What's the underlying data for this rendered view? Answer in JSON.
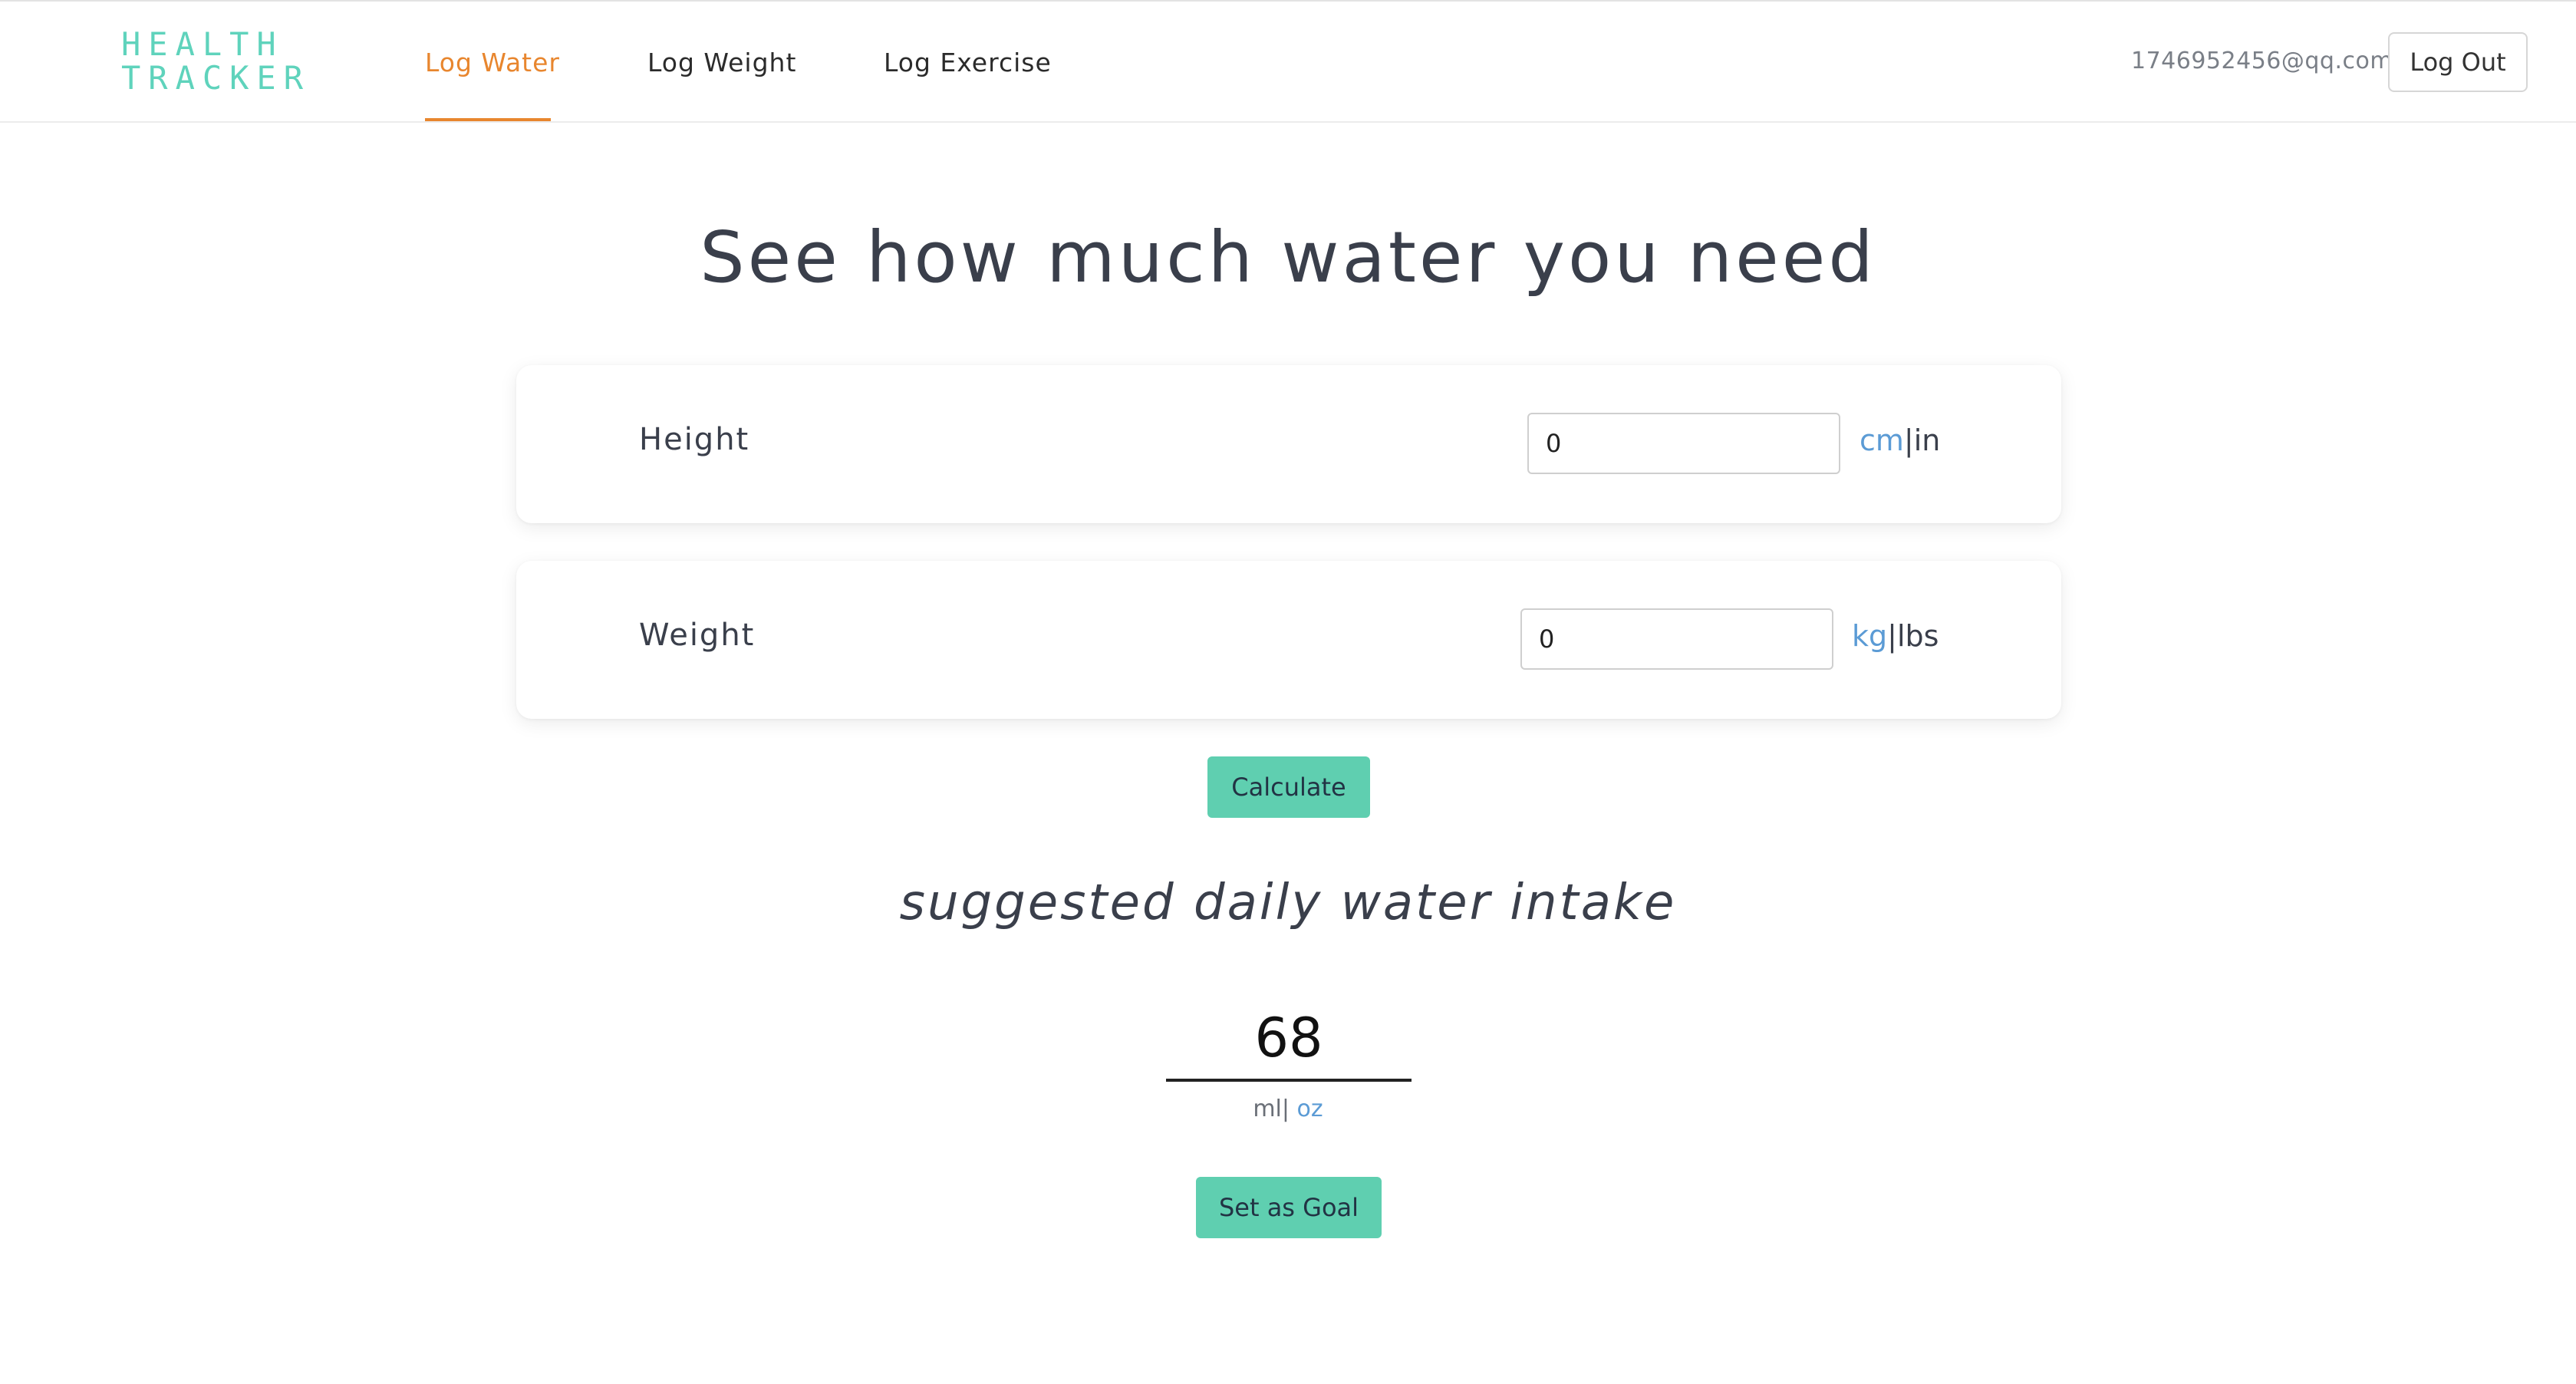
{
  "brand": {
    "logo_line1": "HEALTH",
    "logo_line2": "TRACKER",
    "accent_color": "#5fd3bc"
  },
  "nav": {
    "links": [
      {
        "label": "Log Water",
        "active": true
      },
      {
        "label": "Log Weight",
        "active": false
      },
      {
        "label": "Log Exercise",
        "active": false
      }
    ],
    "active_color": "#e8862e",
    "user_email": "1746952456@qq.com",
    "logout_label": "Log Out"
  },
  "main": {
    "title": "See how much water you need",
    "height": {
      "label": "Height",
      "value": "0",
      "unit_active": "cm",
      "unit_separator": "|",
      "unit_other": "in"
    },
    "weight": {
      "label": "Weight",
      "value": "0",
      "unit_active": "kg",
      "unit_separator": "|",
      "unit_other": "lbs"
    },
    "calculate_label": "Calculate",
    "suggestion_label": "suggested daily water intake",
    "result": {
      "value": "68",
      "unit_other": "ml",
      "unit_separator": "| ",
      "unit_active": "oz"
    },
    "set_goal_label": "Set as Goal"
  },
  "colors": {
    "button_bg": "#5fcfb0",
    "link_blue": "#5b9bd5",
    "text": "#3a3f4b"
  }
}
